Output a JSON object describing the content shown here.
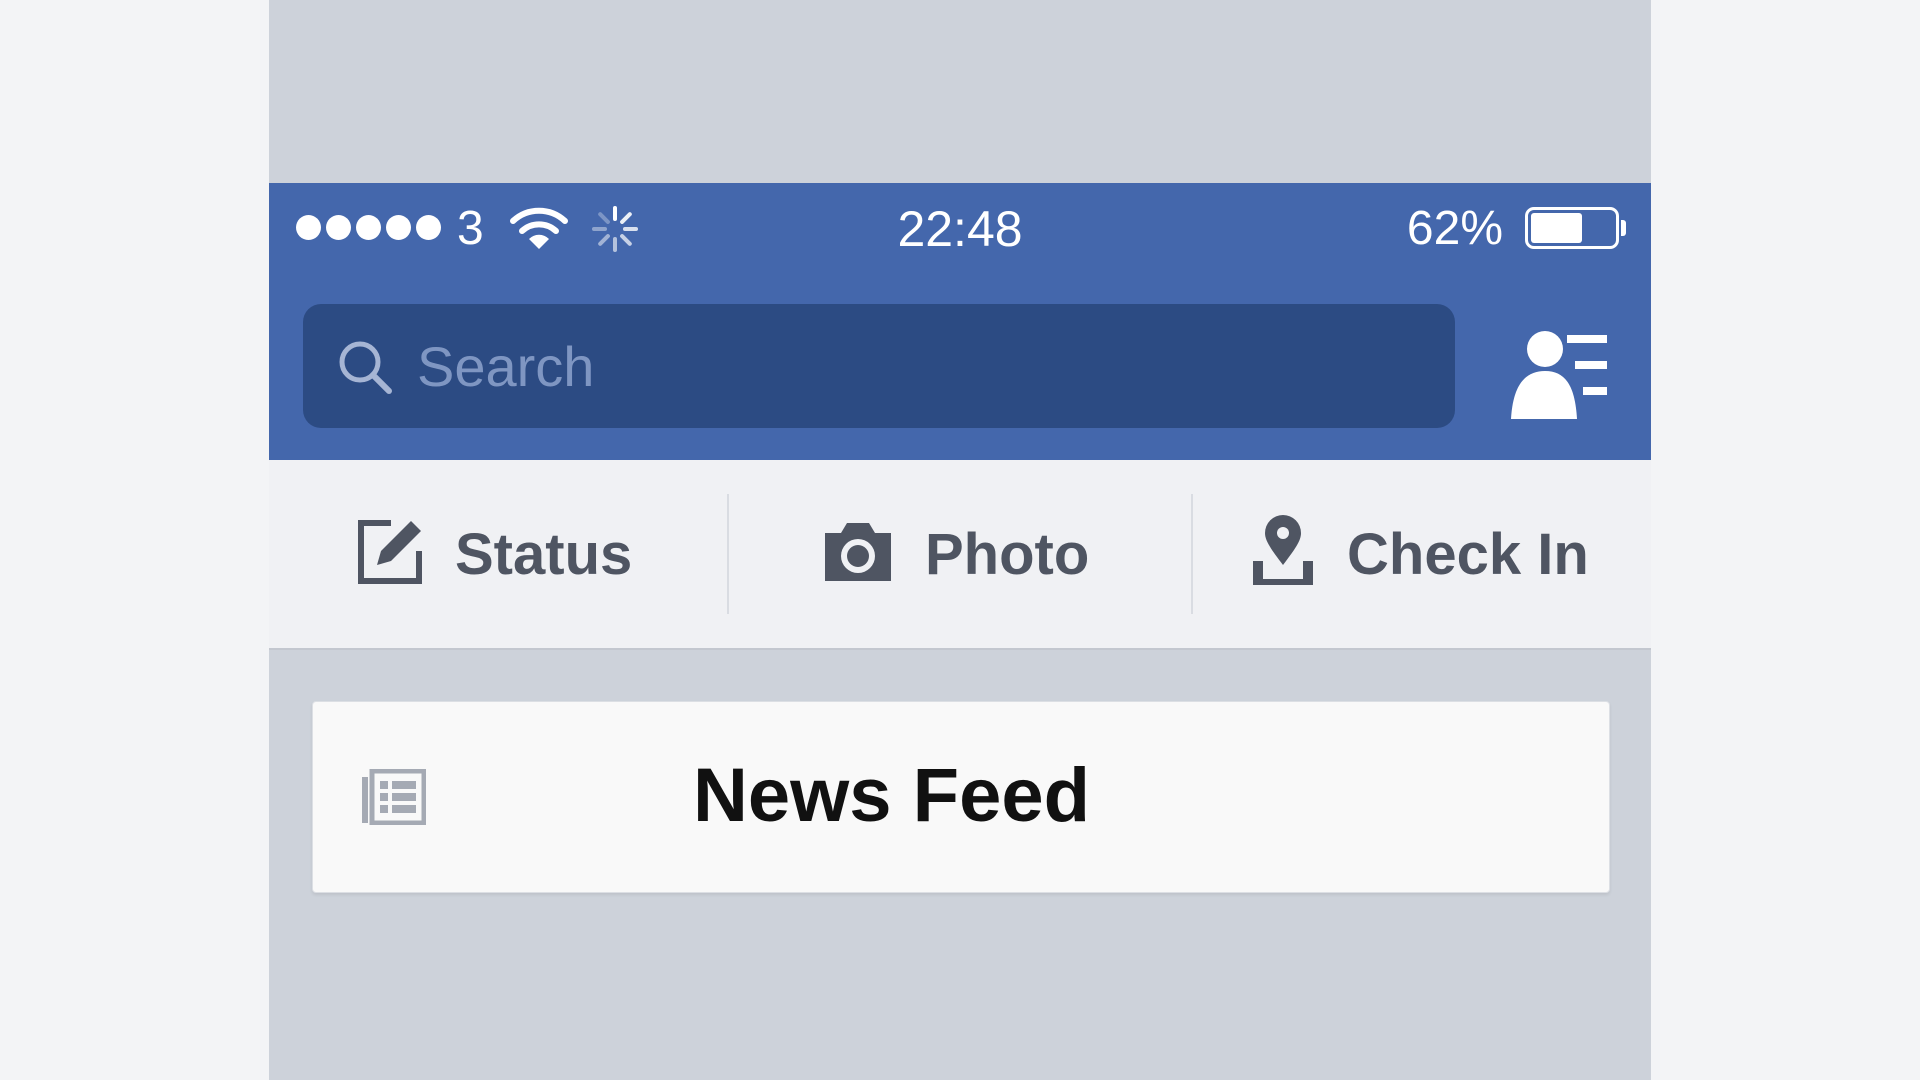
{
  "status_bar": {
    "carrier": "3",
    "signal_strength": "5 of 5",
    "time": "22:48",
    "battery_percent": "62%",
    "battery_level": 0.62,
    "icons": [
      "signal-dots-icon",
      "wifi-icon",
      "activity-spinner-icon",
      "battery-icon"
    ]
  },
  "search": {
    "placeholder": "Search",
    "value": "",
    "icon": "search-icon"
  },
  "header_actions": {
    "friends_icon": "friends-list-icon"
  },
  "composer": {
    "items": [
      {
        "label": "Status",
        "icon": "status-edit-icon"
      },
      {
        "label": "Photo",
        "icon": "camera-icon"
      },
      {
        "label": "Check In",
        "icon": "location-pin-icon"
      }
    ]
  },
  "feed": {
    "title": "News Feed",
    "icon": "news-feed-icon"
  },
  "colors": {
    "header_blue": "#4467ac",
    "search_field": "#2c4b83",
    "composer_bg": "#f0f1f4",
    "composer_text": "#4f5562",
    "page_bg": "#cdd2da"
  }
}
